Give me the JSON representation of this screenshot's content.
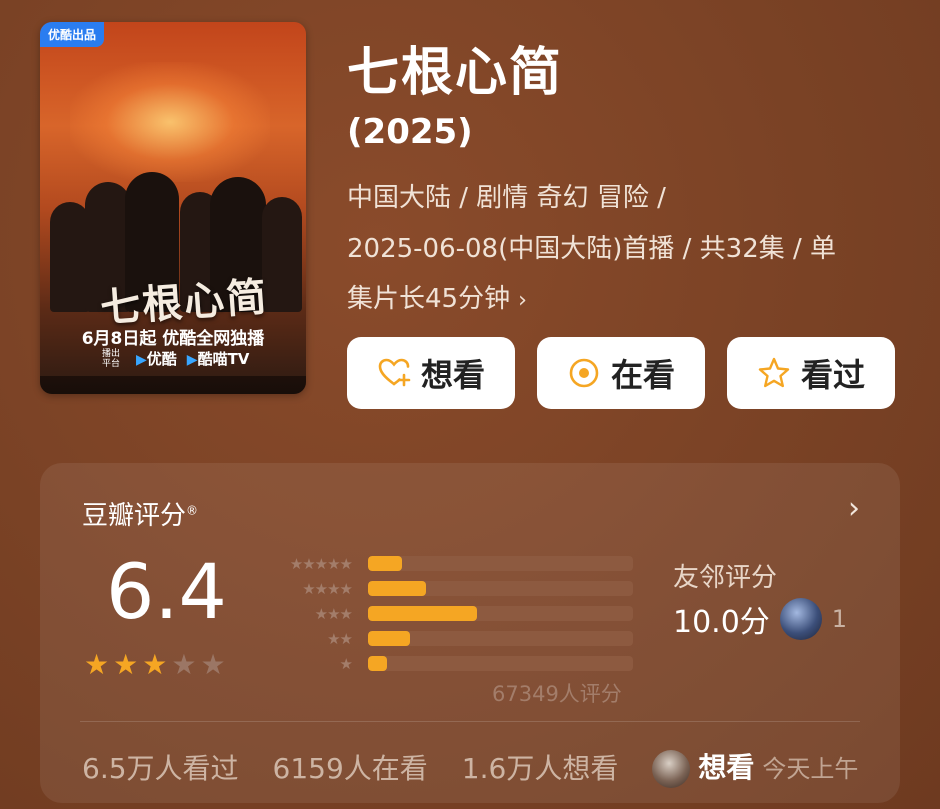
{
  "poster": {
    "badge": "优酷出品",
    "title_art": "七根心简",
    "tagline": "6月8日起 优酷全网独播",
    "platforms": [
      "优酷",
      "酷喵TV"
    ],
    "platform_prefix": "播出平台"
  },
  "title": "七根心简",
  "year": "(2025)",
  "meta_line1": "中国大陆 / 剧情 奇幻 冒险 /",
  "meta_line2": "2025-06-08(中国大陆)首播 / 共32集 / 单",
  "meta_line3": "集片长45分钟",
  "actions": [
    {
      "label": "想看",
      "icon": "heart-plus-icon"
    },
    {
      "label": "在看",
      "icon": "target-icon"
    },
    {
      "label": "看过",
      "icon": "star-outline-icon"
    }
  ],
  "rating": {
    "title": "豆瓣评分",
    "score": "6.4",
    "stars_filled": 3,
    "stars_total": 5,
    "distribution": [
      {
        "label": "★★★★★",
        "fraction": 0.13
      },
      {
        "label": "★★★★",
        "fraction": 0.22
      },
      {
        "label": "★★★",
        "fraction": 0.41
      },
      {
        "label": "★★",
        "fraction": 0.16
      },
      {
        "label": "★",
        "fraction": 0.07
      }
    ],
    "count_text": "67349人评分",
    "friends_label": "友邻评分",
    "friends_score": "10.0分",
    "friends_count": "1"
  },
  "stats": {
    "watched": "6.5万人看过",
    "watching": "6159人在看",
    "wish": "1.6万人想看",
    "activity_label": "想看",
    "activity_time": "今天上午"
  },
  "colors": {
    "accent": "#f5a623",
    "background": "#7a4225"
  }
}
